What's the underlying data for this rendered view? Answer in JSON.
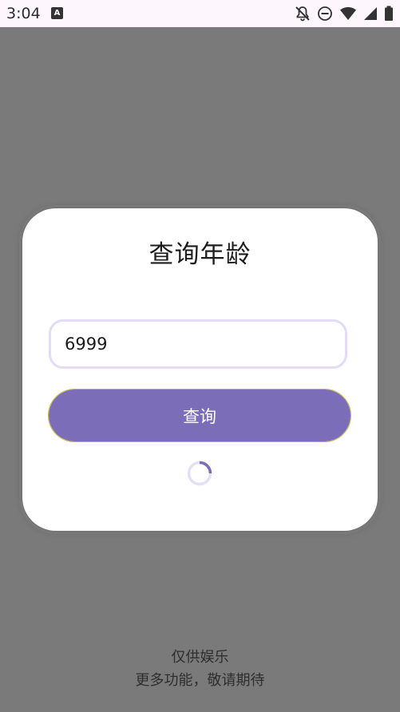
{
  "status_bar": {
    "time": "3:04",
    "icons": [
      "keyboard-a-icon",
      "notifications-off-icon",
      "do-not-disturb-icon",
      "wifi-icon",
      "signal-icon",
      "battery-icon"
    ]
  },
  "dialog": {
    "title": "查询年龄",
    "input_value": "6999",
    "button_label": "查询",
    "loading": true
  },
  "footer": {
    "line1": "仅供娱乐",
    "line2": "更多功能，敬请期待"
  },
  "colors": {
    "scrim": "#7a7a7a",
    "accent": "#7b6db8",
    "input_border": "#e3dcf4",
    "card": "#ffffff"
  }
}
